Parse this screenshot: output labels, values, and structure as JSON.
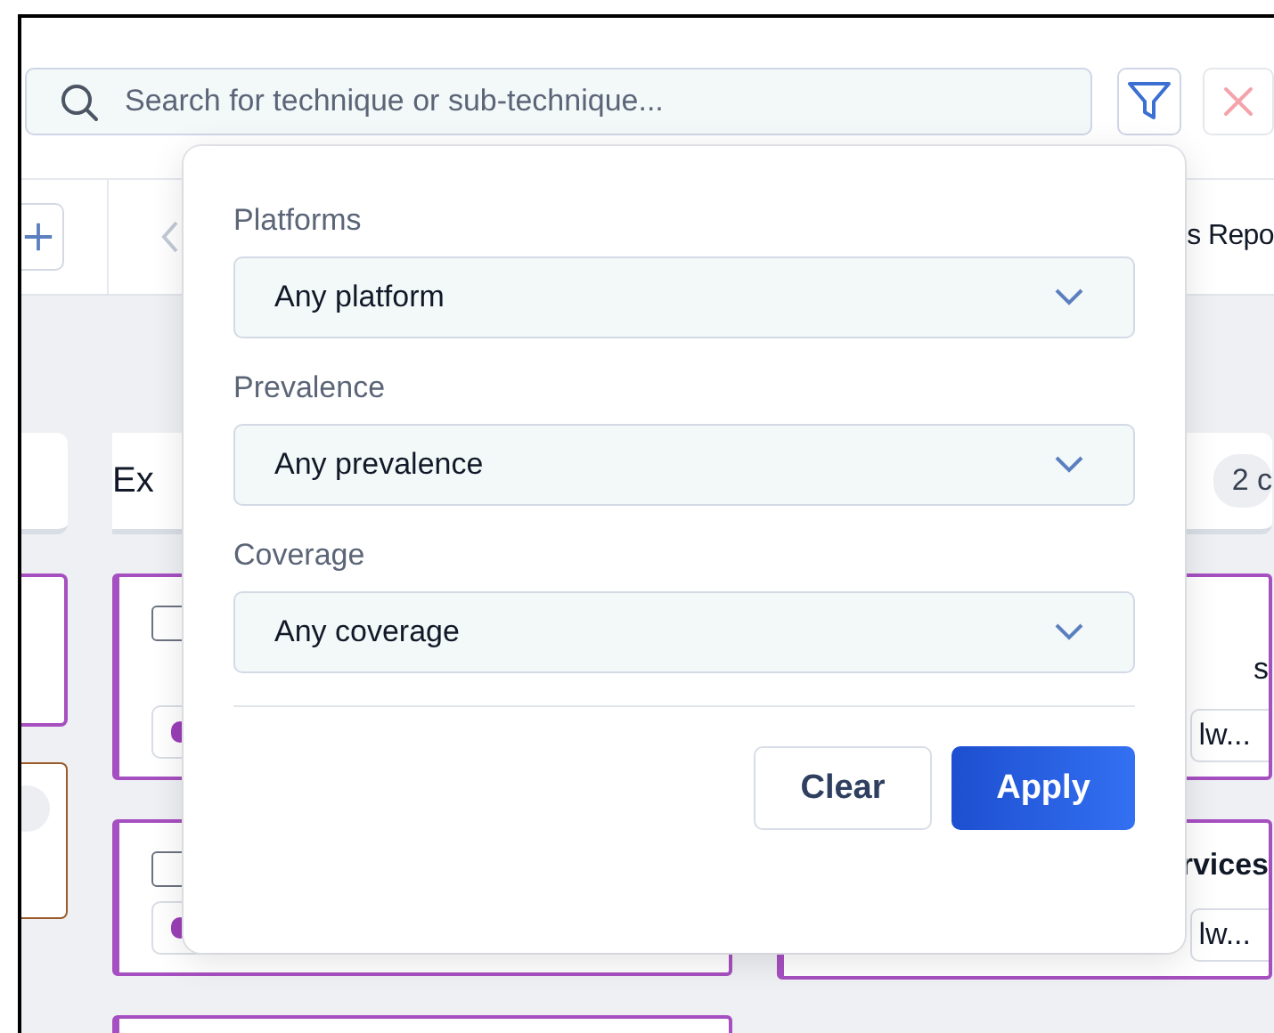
{
  "search": {
    "placeholder": "Search for technique or sub-technique..."
  },
  "tab_bar": {
    "partial_tab": "s Repo"
  },
  "board": {
    "columns": [
      {
        "cards": [
          {
            "kind": "plain"
          },
          {
            "kind": "dot"
          }
        ]
      },
      {
        "header": {
          "title": "Ex"
        },
        "cards": [
          {
            "kind": "check",
            "checked": false
          },
          {
            "kind": "check",
            "checked": false
          },
          {
            "kind": "plain"
          }
        ]
      },
      {
        "header": {
          "badge": "2 c"
        },
        "cards": [
          {
            "kind": "text",
            "title": "s",
            "tag": "lw..."
          },
          {
            "kind": "text",
            "title": "rvices",
            "tag": "lw..."
          }
        ]
      }
    ]
  },
  "filter_popover": {
    "filters": [
      {
        "label": "Platforms",
        "value": "Any platform"
      },
      {
        "label": "Prevalence",
        "value": "Any prevalence"
      },
      {
        "label": "Coverage",
        "value": "Any coverage"
      }
    ],
    "buttons": [
      {
        "kind": "secondary",
        "label": "Clear"
      },
      {
        "kind": "primary",
        "label": "Apply"
      }
    ]
  }
}
